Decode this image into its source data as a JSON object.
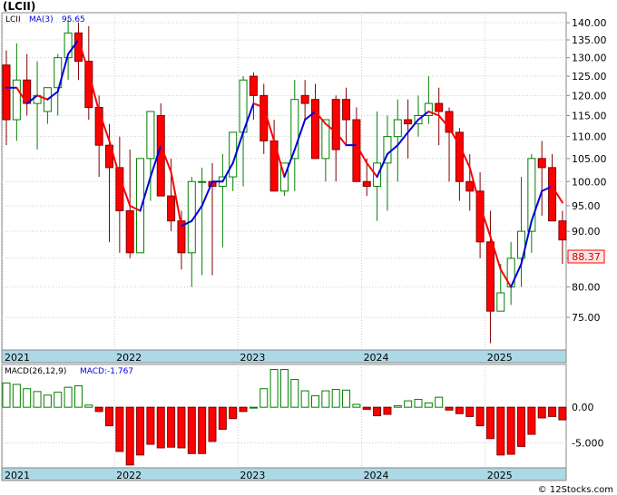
{
  "title": "(LCII)",
  "footer": "© 12Stocks.com",
  "price_panel": {
    "ticker_legend": "LCII",
    "ma_legend_label": "MA(3)",
    "ma_legend_value": "95.65",
    "last_price_label": "88.37",
    "y_ticks": [
      "140.00",
      "135.00",
      "130.00",
      "125.00",
      "120.00",
      "115.00",
      "110.00",
      "105.00",
      "100.00",
      "95.00",
      "90.00",
      "85.00",
      "80.00",
      "75.00"
    ],
    "x_labels": [
      "2021",
      "2022",
      "2023",
      "2024",
      "2025"
    ]
  },
  "macd_panel": {
    "legend_label": "MACD(26,12,9)",
    "legend_value": "MACD:-1.767",
    "y_ticks": [
      "0.00",
      "-5.000"
    ],
    "x_labels": [
      "2021",
      "2022",
      "2023",
      "2024",
      "2025"
    ]
  },
  "colors": {
    "up_candle": "#ffffff",
    "up_border": "#008000",
    "down_candle": "#ff0000",
    "down_border": "#800000",
    "ma_up": "#0000dd",
    "ma_down": "#ff0000",
    "macd_pos": "#ffffff",
    "macd_neg": "#ff0000",
    "axis_band": "#add8e6",
    "last_price_bg": "#ffe4e1"
  },
  "chart_data": [
    {
      "type": "candlestick",
      "title": "(LCII)",
      "interval": "monthly",
      "ylim": [
        70,
        143
      ],
      "y_scale": "log",
      "x": [
        "2021-02",
        "2021-03",
        "2021-04",
        "2021-05",
        "2021-06",
        "2021-07",
        "2021-08",
        "2021-09",
        "2021-10",
        "2021-11",
        "2021-12",
        "2022-01",
        "2022-02",
        "2022-03",
        "2022-04",
        "2022-05",
        "2022-06",
        "2022-07",
        "2022-08",
        "2022-09",
        "2022-10",
        "2022-11",
        "2022-12",
        "2023-01",
        "2023-02",
        "2023-03",
        "2023-04",
        "2023-05",
        "2023-06",
        "2023-07",
        "2023-08",
        "2023-09",
        "2023-10",
        "2023-11",
        "2023-12",
        "2024-01",
        "2024-02",
        "2024-03",
        "2024-04",
        "2024-05",
        "2024-06",
        "2024-07",
        "2024-08",
        "2024-09",
        "2024-10",
        "2024-11",
        "2024-12",
        "2025-01",
        "2025-02",
        "2025-03",
        "2025-04",
        "2025-05",
        "2025-06",
        "2025-07",
        "2025-08",
        "2025-09"
      ],
      "open": [
        128,
        114,
        124,
        118,
        116,
        122,
        130,
        137,
        129,
        117,
        108,
        103,
        94,
        86,
        105,
        115,
        97,
        92,
        86,
        100,
        100,
        99,
        101,
        111,
        125,
        120,
        109,
        98,
        105,
        120,
        119,
        105,
        119,
        119,
        114,
        100,
        99,
        104,
        110,
        114,
        113,
        115,
        118,
        116,
        111,
        100,
        98,
        88,
        76,
        80,
        85,
        90,
        105,
        103,
        92
      ],
      "high": [
        132,
        134,
        131,
        129,
        122,
        131,
        141,
        140,
        139,
        120,
        113,
        110,
        107,
        100,
        109,
        118,
        105,
        94,
        101,
        103,
        104,
        106,
        104,
        125,
        126,
        123,
        114,
        104,
        124,
        124,
        123,
        110,
        120,
        122,
        117,
        105,
        116,
        115,
        119,
        119,
        120,
        125,
        122,
        117,
        112,
        106,
        102,
        94,
        84,
        88,
        101,
        106,
        109,
        106,
        94
      ],
      "low": [
        108,
        109,
        115,
        107,
        113,
        115,
        124,
        124,
        114,
        101,
        88,
        86,
        85,
        86,
        96,
        98,
        90,
        83,
        80,
        82,
        82,
        87,
        98,
        99,
        114,
        106,
        99,
        97,
        98,
        114,
        105,
        100,
        100,
        108,
        100,
        97,
        92,
        94,
        100,
        105,
        110,
        113,
        108,
        100,
        96,
        94,
        85,
        71,
        76,
        77,
        80,
        86,
        93,
        93,
        84
      ],
      "close": [
        114,
        124,
        118,
        120,
        122,
        130,
        137,
        129,
        117,
        108,
        103,
        94,
        86,
        105,
        116,
        97,
        92,
        86,
        100,
        100,
        99,
        101,
        111,
        124,
        120,
        109,
        98,
        104,
        119,
        118,
        105,
        114,
        107,
        114,
        100,
        99,
        104,
        110,
        114,
        113,
        115,
        118,
        116,
        111,
        100,
        98,
        88,
        76,
        79,
        85,
        90,
        105,
        103,
        92,
        88.37
      ],
      "ma3": [
        122,
        122,
        118,
        120,
        119,
        121,
        131,
        135,
        126,
        116,
        109,
        101,
        95,
        94,
        101,
        108,
        102,
        91,
        92,
        95,
        100,
        100,
        104,
        111,
        118,
        117,
        109,
        101,
        107,
        114,
        116,
        113,
        111,
        108,
        108,
        104,
        101,
        106,
        108,
        111,
        114,
        116,
        115,
        112,
        108,
        103,
        95,
        89,
        83,
        80,
        84,
        92,
        98,
        99,
        95.65
      ],
      "last": 88.37
    },
    {
      "type": "bar",
      "title": "MACD(26,12,9)",
      "ylim": [
        -8.5,
        6
      ],
      "x": [
        "2021-02",
        "2021-03",
        "2021-04",
        "2021-05",
        "2021-06",
        "2021-07",
        "2021-08",
        "2021-09",
        "2021-10",
        "2021-11",
        "2021-12",
        "2022-01",
        "2022-02",
        "2022-03",
        "2022-04",
        "2022-05",
        "2022-06",
        "2022-07",
        "2022-08",
        "2022-09",
        "2022-10",
        "2022-11",
        "2022-12",
        "2023-01",
        "2023-02",
        "2023-03",
        "2023-04",
        "2023-05",
        "2023-06",
        "2023-07",
        "2023-08",
        "2023-09",
        "2023-10",
        "2023-11",
        "2023-12",
        "2024-01",
        "2024-02",
        "2024-03",
        "2024-04",
        "2024-05",
        "2024-06",
        "2024-07",
        "2024-08",
        "2024-09",
        "2024-10",
        "2024-11",
        "2024-12",
        "2025-01",
        "2025-02",
        "2025-03",
        "2025-04",
        "2025-05",
        "2025-06",
        "2025-07",
        "2025-08",
        "2025-09"
      ],
      "values": [
        3.4,
        3.2,
        2.6,
        2.2,
        1.7,
        2.1,
        2.8,
        3.0,
        0.3,
        -0.6,
        -2.6,
        -6.2,
        -8.1,
        -6.7,
        -5.2,
        -5.7,
        -5.6,
        -5.7,
        -6.5,
        -6.5,
        -4.8,
        -3.1,
        -1.6,
        -0.6,
        0.0,
        2.6,
        5.3,
        5.3,
        3.9,
        2.3,
        1.6,
        2.3,
        2.5,
        2.4,
        0.4,
        -0.3,
        -1.2,
        -1.0,
        0.2,
        0.9,
        1.1,
        0.6,
        1.4,
        -0.4,
        -0.9,
        -1.3,
        -2.6,
        -4.4,
        -6.7,
        -6.6,
        -5.5,
        -3.8,
        -1.5,
        -1.3,
        -1.767
      ],
      "last": -1.767
    }
  ]
}
